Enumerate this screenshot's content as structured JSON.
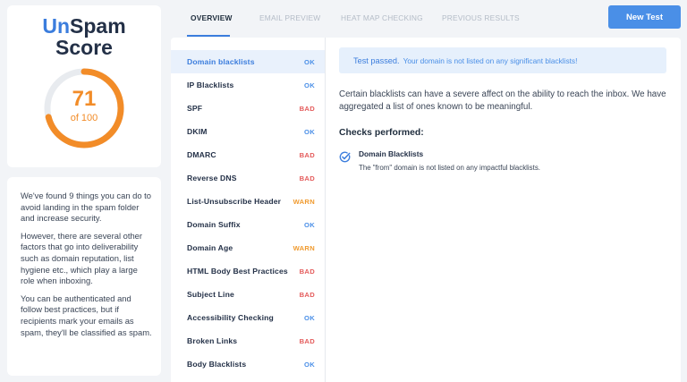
{
  "brand": {
    "part1": "Un",
    "part2": "Spam",
    "line2": "Score"
  },
  "score": {
    "value": "71",
    "of": "of 100",
    "fraction": 0.71,
    "color": "#f28c28"
  },
  "info": {
    "paragraphs": [
      "We've found 9 things you can do to avoid landing in the spam folder and increase security.",
      "However, there are several other factors that go into deliverability such as domain reputation, list hygiene etc., which play a large role when inboxing.",
      "You can be authenticated and follow best practices, but if recipients mark your emails as spam, they'll be classified as spam."
    ]
  },
  "tabs": [
    {
      "label": "OVERVIEW",
      "active": true
    },
    {
      "label": "EMAIL PREVIEW",
      "active": false
    },
    {
      "label": "HEAT MAP CHECKING",
      "active": false
    },
    {
      "label": "PREVIOUS RESULTS",
      "active": false
    }
  ],
  "new_test_label": "New Test",
  "checks": [
    {
      "name": "Domain blacklists",
      "status": "OK"
    },
    {
      "name": "IP Blacklists",
      "status": "OK"
    },
    {
      "name": "SPF",
      "status": "BAD"
    },
    {
      "name": "DKIM",
      "status": "OK"
    },
    {
      "name": "DMARC",
      "status": "BAD"
    },
    {
      "name": "Reverse DNS",
      "status": "BAD"
    },
    {
      "name": "List-Unsubscribe Header",
      "status": "WARN"
    },
    {
      "name": "Domain Suffix",
      "status": "OK"
    },
    {
      "name": "Domain Age",
      "status": "WARN"
    },
    {
      "name": "HTML Body Best Practices",
      "status": "BAD"
    },
    {
      "name": "Subject Line",
      "status": "BAD"
    },
    {
      "name": "Accessibility Checking",
      "status": "OK"
    },
    {
      "name": "Broken Links",
      "status": "BAD"
    },
    {
      "name": "Body Blacklists",
      "status": "OK"
    }
  ],
  "detail": {
    "alert_strong": "Test passed.",
    "alert_text": "Your domain is not listed on any significant blacklists!",
    "description": "Certain blacklists can have a severe affect on the ability to reach the inbox. We have aggregated a list of ones known to be meaningful.",
    "checks_heading": "Checks performed:",
    "performed": [
      {
        "title": "Domain Blacklists",
        "desc": "The \"from\" domain is not listed on any impactful blacklists.",
        "icon": "check-badge-icon"
      }
    ]
  },
  "colors": {
    "accent": "#3b7ddd",
    "ok": "#4a8fe7",
    "bad": "#e45b5b",
    "warn": "#f09a2e"
  }
}
